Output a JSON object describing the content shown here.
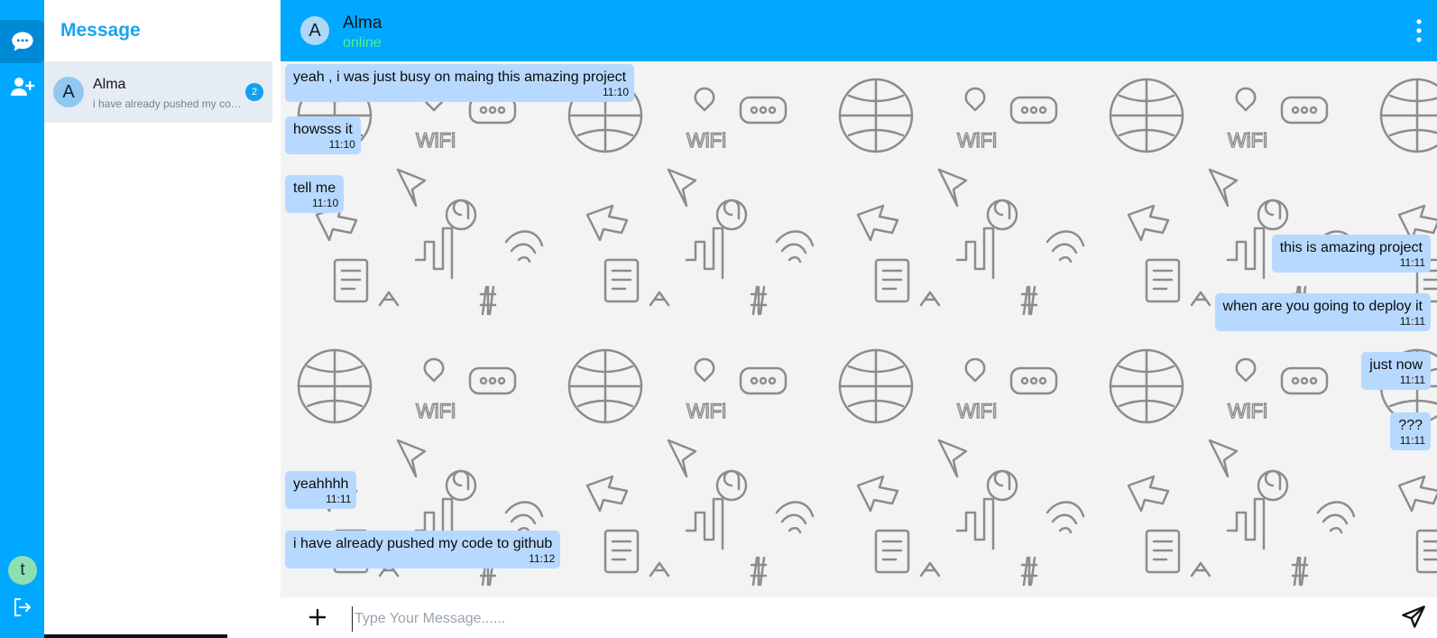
{
  "sidebar": {
    "title": "Message",
    "user_initial": "t",
    "contacts": [
      {
        "initial": "A",
        "name": "Alma",
        "preview": "i have already pushed my code to github",
        "unread": "2"
      }
    ]
  },
  "chat": {
    "contact_initial": "A",
    "contact_name": "Alma",
    "status": "online",
    "messages": [
      {
        "text": "yeah , i was just busy on maing this amazing project",
        "time": "11:10",
        "side": "left"
      },
      {
        "text": "howsss it",
        "time": "11:10",
        "side": "left"
      },
      {
        "text": "tell me",
        "time": "11:10",
        "side": "left"
      },
      {
        "text": "this is amazing project",
        "time": "11:11",
        "side": "right"
      },
      {
        "text": "when are you going to deploy it",
        "time": "11:11",
        "side": "right"
      },
      {
        "text": "just now",
        "time": "11:11",
        "side": "right"
      },
      {
        "text": "???",
        "time": "11:11",
        "side": "right"
      },
      {
        "text": "yeahhhh",
        "time": "11:11",
        "side": "left"
      },
      {
        "text": "i have already pushed my code to github",
        "time": "11:12",
        "side": "left"
      }
    ]
  },
  "composer": {
    "placeholder": "Type Your Message......",
    "value": ""
  },
  "colors": {
    "primary": "#00a8ff",
    "bubble": "#b8d9ff",
    "online": "#4ff08a"
  },
  "icons": [
    "chat-icon",
    "add-user-icon",
    "logout-icon",
    "kebab-menu-icon",
    "plus-icon",
    "send-icon"
  ]
}
